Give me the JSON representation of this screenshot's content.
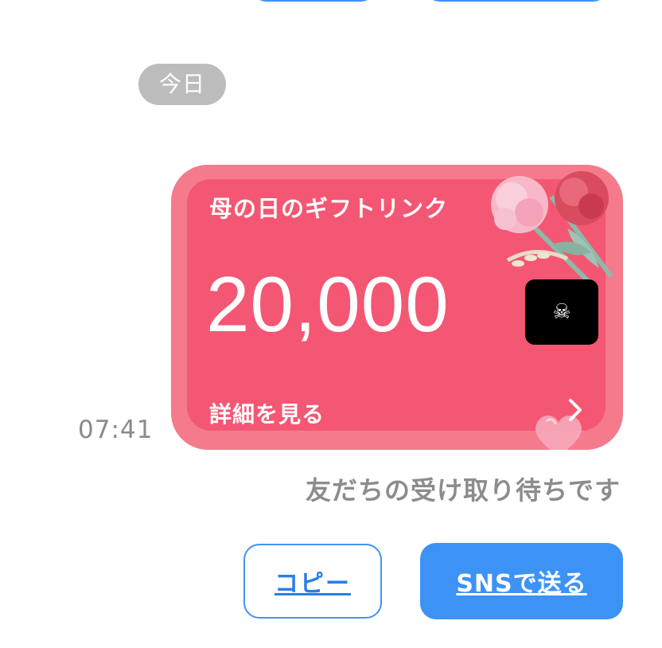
{
  "chat": {
    "date_separator": "今日",
    "timestamp": "07:41"
  },
  "gift_card": {
    "title": "母の日のギフトリンク",
    "amount": "20,000",
    "detail_link": "詳細を見る",
    "coin_icon": "☠",
    "colors": {
      "outer": "#f57a8c",
      "inner": "#f45773"
    }
  },
  "status": {
    "waiting_text": "友だちの受け取り待ちです"
  },
  "actions": {
    "copy_label": "コピー",
    "sns_label": "SNSで送る",
    "accent_color": "#3d93f5"
  },
  "icons": {
    "coin": "pirate-flag-icon",
    "chevron": "chevron-right-icon",
    "decoration": "carnation-flowers-icon",
    "heart": "heart-icon"
  }
}
